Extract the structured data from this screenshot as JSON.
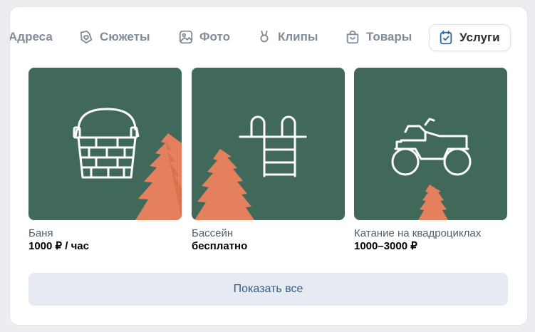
{
  "tabs": [
    {
      "label": "Адреса",
      "icon": "map-pin-icon",
      "active": false
    },
    {
      "label": "Сюжеты",
      "icon": "heart-story-icon",
      "active": false
    },
    {
      "label": "Фото",
      "icon": "photo-icon",
      "active": false
    },
    {
      "label": "Клипы",
      "icon": "clips-icon",
      "active": false
    },
    {
      "label": "Товары",
      "icon": "shopping-bag-icon",
      "active": false
    },
    {
      "label": "Услуги",
      "icon": "calendar-check-icon",
      "active": true
    }
  ],
  "services": [
    {
      "name": "Баня",
      "price": "1000 ₽ / час",
      "icon": "sauna-bucket-icon"
    },
    {
      "name": "Бассейн",
      "price": "бесплатно",
      "icon": "pool-ladder-icon"
    },
    {
      "name": "Катание на квадроциклах",
      "price": "1000–3000 ₽",
      "icon": "quad-bike-icon"
    }
  ],
  "show_all_label": "Показать все",
  "colors": {
    "thumb_bg": "#41695a",
    "tree": "#e5805e",
    "accent": "#2c6ca6",
    "button_bg": "#e5ebf1"
  }
}
